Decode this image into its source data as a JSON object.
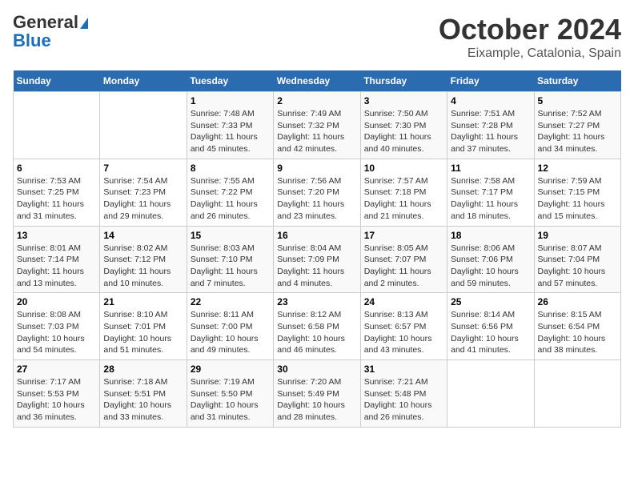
{
  "header": {
    "logo_line1": "General",
    "logo_line2": "Blue",
    "title": "October 2024",
    "subtitle": "Eixample, Catalonia, Spain"
  },
  "days_of_week": [
    "Sunday",
    "Monday",
    "Tuesday",
    "Wednesday",
    "Thursday",
    "Friday",
    "Saturday"
  ],
  "weeks": [
    [
      {
        "day": "",
        "info": ""
      },
      {
        "day": "",
        "info": ""
      },
      {
        "day": "1",
        "info": "Sunrise: 7:48 AM\nSunset: 7:33 PM\nDaylight: 11 hours and 45 minutes."
      },
      {
        "day": "2",
        "info": "Sunrise: 7:49 AM\nSunset: 7:32 PM\nDaylight: 11 hours and 42 minutes."
      },
      {
        "day": "3",
        "info": "Sunrise: 7:50 AM\nSunset: 7:30 PM\nDaylight: 11 hours and 40 minutes."
      },
      {
        "day": "4",
        "info": "Sunrise: 7:51 AM\nSunset: 7:28 PM\nDaylight: 11 hours and 37 minutes."
      },
      {
        "day": "5",
        "info": "Sunrise: 7:52 AM\nSunset: 7:27 PM\nDaylight: 11 hours and 34 minutes."
      }
    ],
    [
      {
        "day": "6",
        "info": "Sunrise: 7:53 AM\nSunset: 7:25 PM\nDaylight: 11 hours and 31 minutes."
      },
      {
        "day": "7",
        "info": "Sunrise: 7:54 AM\nSunset: 7:23 PM\nDaylight: 11 hours and 29 minutes."
      },
      {
        "day": "8",
        "info": "Sunrise: 7:55 AM\nSunset: 7:22 PM\nDaylight: 11 hours and 26 minutes."
      },
      {
        "day": "9",
        "info": "Sunrise: 7:56 AM\nSunset: 7:20 PM\nDaylight: 11 hours and 23 minutes."
      },
      {
        "day": "10",
        "info": "Sunrise: 7:57 AM\nSunset: 7:18 PM\nDaylight: 11 hours and 21 minutes."
      },
      {
        "day": "11",
        "info": "Sunrise: 7:58 AM\nSunset: 7:17 PM\nDaylight: 11 hours and 18 minutes."
      },
      {
        "day": "12",
        "info": "Sunrise: 7:59 AM\nSunset: 7:15 PM\nDaylight: 11 hours and 15 minutes."
      }
    ],
    [
      {
        "day": "13",
        "info": "Sunrise: 8:01 AM\nSunset: 7:14 PM\nDaylight: 11 hours and 13 minutes."
      },
      {
        "day": "14",
        "info": "Sunrise: 8:02 AM\nSunset: 7:12 PM\nDaylight: 11 hours and 10 minutes."
      },
      {
        "day": "15",
        "info": "Sunrise: 8:03 AM\nSunset: 7:10 PM\nDaylight: 11 hours and 7 minutes."
      },
      {
        "day": "16",
        "info": "Sunrise: 8:04 AM\nSunset: 7:09 PM\nDaylight: 11 hours and 4 minutes."
      },
      {
        "day": "17",
        "info": "Sunrise: 8:05 AM\nSunset: 7:07 PM\nDaylight: 11 hours and 2 minutes."
      },
      {
        "day": "18",
        "info": "Sunrise: 8:06 AM\nSunset: 7:06 PM\nDaylight: 10 hours and 59 minutes."
      },
      {
        "day": "19",
        "info": "Sunrise: 8:07 AM\nSunset: 7:04 PM\nDaylight: 10 hours and 57 minutes."
      }
    ],
    [
      {
        "day": "20",
        "info": "Sunrise: 8:08 AM\nSunset: 7:03 PM\nDaylight: 10 hours and 54 minutes."
      },
      {
        "day": "21",
        "info": "Sunrise: 8:10 AM\nSunset: 7:01 PM\nDaylight: 10 hours and 51 minutes."
      },
      {
        "day": "22",
        "info": "Sunrise: 8:11 AM\nSunset: 7:00 PM\nDaylight: 10 hours and 49 minutes."
      },
      {
        "day": "23",
        "info": "Sunrise: 8:12 AM\nSunset: 6:58 PM\nDaylight: 10 hours and 46 minutes."
      },
      {
        "day": "24",
        "info": "Sunrise: 8:13 AM\nSunset: 6:57 PM\nDaylight: 10 hours and 43 minutes."
      },
      {
        "day": "25",
        "info": "Sunrise: 8:14 AM\nSunset: 6:56 PM\nDaylight: 10 hours and 41 minutes."
      },
      {
        "day": "26",
        "info": "Sunrise: 8:15 AM\nSunset: 6:54 PM\nDaylight: 10 hours and 38 minutes."
      }
    ],
    [
      {
        "day": "27",
        "info": "Sunrise: 7:17 AM\nSunset: 5:53 PM\nDaylight: 10 hours and 36 minutes."
      },
      {
        "day": "28",
        "info": "Sunrise: 7:18 AM\nSunset: 5:51 PM\nDaylight: 10 hours and 33 minutes."
      },
      {
        "day": "29",
        "info": "Sunrise: 7:19 AM\nSunset: 5:50 PM\nDaylight: 10 hours and 31 minutes."
      },
      {
        "day": "30",
        "info": "Sunrise: 7:20 AM\nSunset: 5:49 PM\nDaylight: 10 hours and 28 minutes."
      },
      {
        "day": "31",
        "info": "Sunrise: 7:21 AM\nSunset: 5:48 PM\nDaylight: 10 hours and 26 minutes."
      },
      {
        "day": "",
        "info": ""
      },
      {
        "day": "",
        "info": ""
      }
    ]
  ]
}
